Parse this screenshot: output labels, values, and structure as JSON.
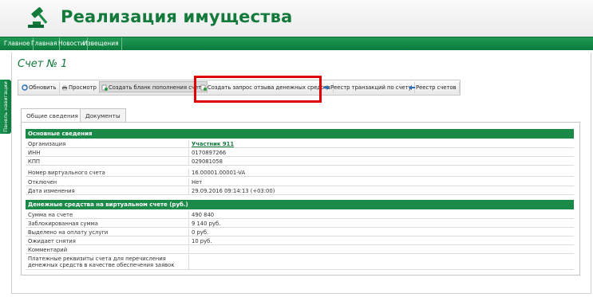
{
  "app": {
    "title": "Реализация имущества"
  },
  "nav": {
    "items": [
      "Главное",
      "Главная",
      "Новости",
      "Извещения"
    ]
  },
  "side_tab": {
    "label": "Панель навигации"
  },
  "page": {
    "title": "Счет № 1"
  },
  "toolbar": {
    "buttons": [
      {
        "label": "Обновить",
        "icon": "refresh-icon"
      },
      {
        "label": "Просмотр",
        "icon": "print-icon"
      },
      {
        "label": "Создать бланк пополнения счета",
        "icon": "doc-create-icon"
      },
      {
        "label": "Создать запрос отзыва денежных средств",
        "icon": "doc-create-icon"
      },
      {
        "label": "Реестр транзакций по счету",
        "icon": "arrow-right-icon"
      },
      {
        "label": "Реестр счетов",
        "icon": "arrow-left-icon"
      }
    ]
  },
  "tabs": [
    "Общие сведения",
    "Документы"
  ],
  "sections": {
    "main": {
      "title": "Основные сведения",
      "rows": [
        {
          "label": "Организация",
          "value": "Участник 911"
        },
        {
          "label": "ИНН",
          "value": "0170897266"
        },
        {
          "label": "КПП",
          "value": "029081058"
        },
        {
          "label": "Номер виртуального счета",
          "value": "16.00001.00001-VA"
        },
        {
          "label": "Отключен",
          "value": "Нет"
        },
        {
          "label": "Дата изменения",
          "value": "29.09.2016 09:14:13 (+03:00)"
        }
      ]
    },
    "funds": {
      "title": "Денежные средства на виртуальном счете (руб.)",
      "rows": [
        {
          "label": "Сумма на счете",
          "value": "490 840"
        },
        {
          "label": "Заблокированная сумма",
          "value": "9 140 руб."
        },
        {
          "label": "Выделено на оплату услуги",
          "value": "0 руб."
        },
        {
          "label": "Ожидает снятия",
          "value": "10 руб."
        },
        {
          "label": "Комментарий",
          "value": ""
        },
        {
          "label": "Платежные реквизиты счета для перечисления денежных средств в качестве обеспечения заявок",
          "value": ""
        }
      ]
    }
  },
  "colors": {
    "brand_green": "#137a3c",
    "nav_green": "#0c7a3c",
    "highlight": "#e00000"
  }
}
